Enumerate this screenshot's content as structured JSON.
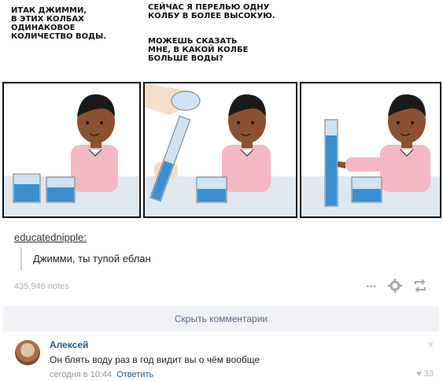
{
  "comic": {
    "caption1": "Итак Джимми,\nв этих колбах\nодинаковое\nколичество воды.",
    "caption2a": "Сейчас я перелью одну\nколбу в более высокую.",
    "caption2b": "Можешь сказать\nмне, в какой колбе\nбольше воды?"
  },
  "post": {
    "author": "educatednipple:",
    "quote": "Джимми, ты тупой еблан",
    "notes": "435,946 notes",
    "dots": "•••"
  },
  "hide_comments": "Скрыть комментарии",
  "comment": {
    "name": "Алексей",
    "text": "Он блять воду раз в год видит вы о чём вообще",
    "time": "сегодня в 10:44",
    "reply": "Ответить",
    "likes": "33",
    "close": "×"
  },
  "colors": {
    "water": "#3a8fd1",
    "shirt": "#f3b8c3",
    "link": "#2a5885",
    "bar_bg": "#f0f2f5"
  }
}
